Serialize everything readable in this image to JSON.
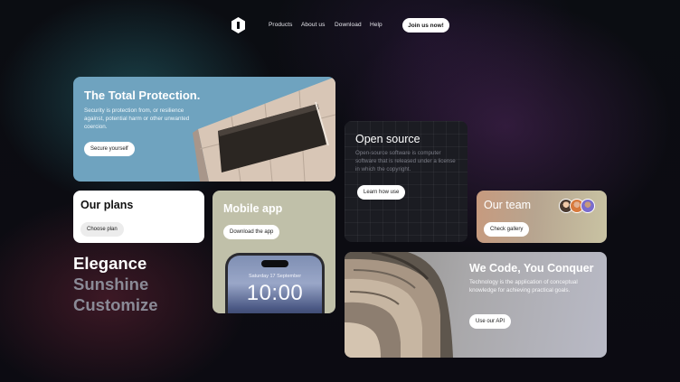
{
  "nav": {
    "links": [
      "Products",
      "About us",
      "Download",
      "Help"
    ],
    "cta": "Join us now!"
  },
  "cards": {
    "protection": {
      "title": "The Total Protection.",
      "description": "Security is protection from, or resilience against, potential harm or other unwanted coercion.",
      "button": "Secure yourself"
    },
    "open_source": {
      "title": "Open source",
      "description": "Open-source software is computer software that is released under a license in which the copyright.",
      "button": "Learn how use"
    },
    "plans": {
      "title": "Our plans",
      "button": "Choose plan"
    },
    "mobile": {
      "title": "Mobile app",
      "button": "Download the app",
      "phone_date": "Saturday 17 September",
      "phone_time": "10:00"
    },
    "team": {
      "title": "Our team",
      "button": "Check gallery"
    },
    "code": {
      "title": "We Code, You Conquer",
      "description": "Technology is the application of conceptual knowledge for achieving practical goals.",
      "button": "Use our API"
    }
  },
  "taglines": [
    "Elegance",
    "Sunshine",
    "Customize"
  ],
  "colors": {
    "background": "#0a0c10",
    "protection_card": "#6fa3bf",
    "open_source_card": "#1b1c22",
    "mobile_card": "#c0c0a9",
    "tagline_primary": "#ffffff",
    "tagline_muted": "#8a8a96"
  }
}
